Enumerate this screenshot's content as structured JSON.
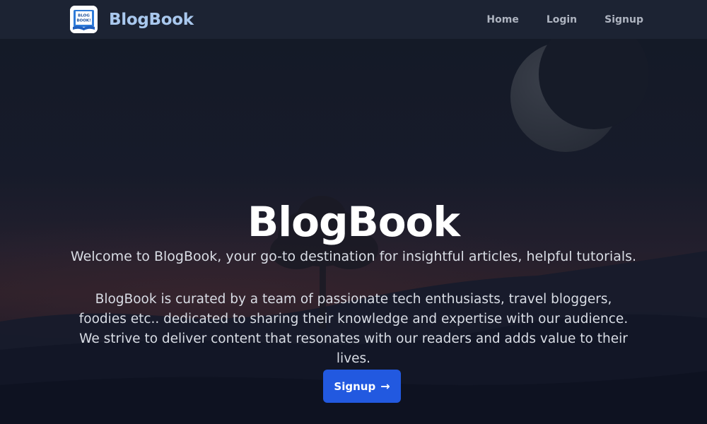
{
  "header": {
    "brand": "BlogBook",
    "logo_text": [
      "BLOG",
      "BOOK!"
    ],
    "nav": [
      {
        "label": "Home"
      },
      {
        "label": "Login"
      },
      {
        "label": "Signup"
      }
    ]
  },
  "hero": {
    "title": "BlogBook",
    "tagline": "Welcome to BlogBook, your go-to destination for insightful articles, helpful tutorials.",
    "description": "BlogBook is curated by a team of passionate tech enthusiasts, travel bloggers, foodies etc.. dedicated to sharing their knowledge and expertise with our audience. We strive to deliver content that resonates with our readers and adds value to their lives.",
    "cta_label": "Signup",
    "cta_icon": "arrow-right-icon"
  },
  "colors": {
    "navbar_bg": "#1c2333",
    "brand_text": "#a9c8ee",
    "accent": "#2259e0",
    "hero_text": "#ffffff"
  }
}
